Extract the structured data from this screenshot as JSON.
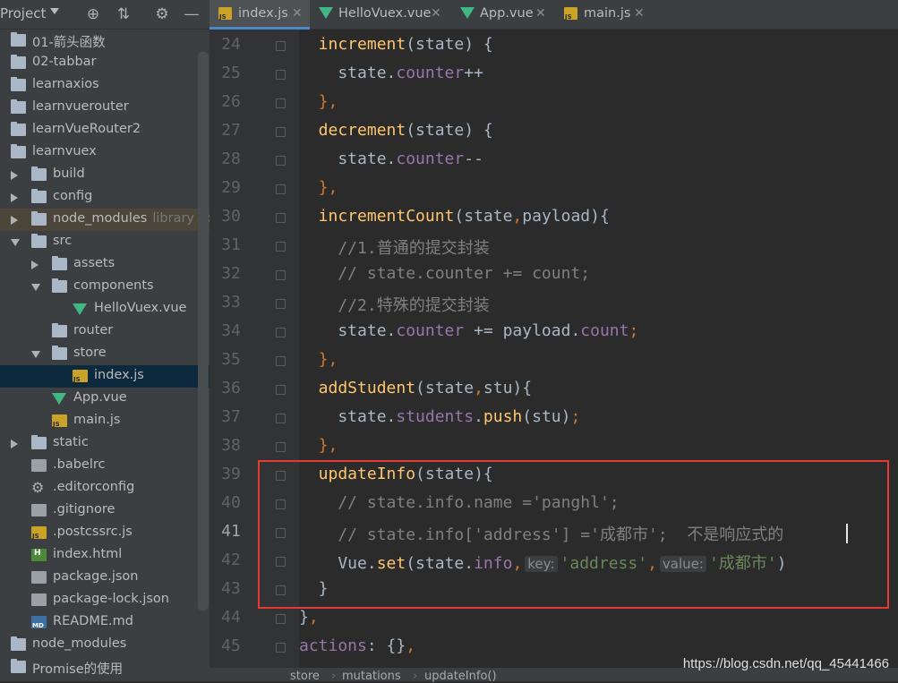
{
  "sidebar": {
    "title": "Project",
    "tools": [
      "target-icon",
      "collapse-icon",
      "gear-icon",
      "minimize-icon"
    ],
    "items": [
      {
        "label": "01-箭头函数",
        "icon": "folder",
        "depth": 0,
        "arrow": "none"
      },
      {
        "label": "02-tabbar",
        "icon": "folder",
        "depth": 0,
        "arrow": "none"
      },
      {
        "label": "learnaxios",
        "icon": "folder",
        "depth": 0,
        "arrow": "none"
      },
      {
        "label": "learnvuerouter",
        "icon": "folder",
        "depth": 0,
        "arrow": "none"
      },
      {
        "label": "learnVueRouter2",
        "icon": "folder",
        "depth": 0,
        "arrow": "none"
      },
      {
        "label": "learnvuex",
        "icon": "folder",
        "depth": 0,
        "arrow": "none"
      },
      {
        "label": "build",
        "icon": "folder",
        "depth": 1,
        "arrow": "right"
      },
      {
        "label": "config",
        "icon": "folder",
        "depth": 1,
        "arrow": "right"
      },
      {
        "label": "node_modules",
        "icon": "folder",
        "depth": 1,
        "arrow": "right",
        "suffix": "library roo",
        "state": "excluded"
      },
      {
        "label": "src",
        "icon": "folder",
        "depth": 1,
        "arrow": "down"
      },
      {
        "label": "assets",
        "icon": "folder",
        "depth": 2,
        "arrow": "right"
      },
      {
        "label": "components",
        "icon": "folder",
        "depth": 2,
        "arrow": "down"
      },
      {
        "label": "HelloVuex.vue",
        "icon": "vue",
        "depth": 3,
        "arrow": "none"
      },
      {
        "label": "router",
        "icon": "folder",
        "depth": 2,
        "arrow": "none"
      },
      {
        "label": "store",
        "icon": "folder",
        "depth": 2,
        "arrow": "down"
      },
      {
        "label": "index.js",
        "icon": "js",
        "depth": 3,
        "arrow": "none",
        "state": "selected"
      },
      {
        "label": "App.vue",
        "icon": "vue",
        "depth": 2,
        "arrow": "none"
      },
      {
        "label": "main.js",
        "icon": "js",
        "depth": 2,
        "arrow": "none"
      },
      {
        "label": "static",
        "icon": "folder",
        "depth": 1,
        "arrow": "right"
      },
      {
        "label": ".babelrc",
        "icon": "file",
        "depth": 1,
        "arrow": "none"
      },
      {
        "label": ".editorconfig",
        "icon": "gear",
        "depth": 1,
        "arrow": "none"
      },
      {
        "label": ".gitignore",
        "icon": "file",
        "depth": 1,
        "arrow": "none"
      },
      {
        "label": ".postcssrc.js",
        "icon": "js",
        "depth": 1,
        "arrow": "none"
      },
      {
        "label": "index.html",
        "icon": "html",
        "depth": 1,
        "arrow": "none"
      },
      {
        "label": "package.json",
        "icon": "file",
        "depth": 1,
        "arrow": "none"
      },
      {
        "label": "package-lock.json",
        "icon": "file",
        "depth": 1,
        "arrow": "none"
      },
      {
        "label": "README.md",
        "icon": "md",
        "depth": 1,
        "arrow": "none"
      },
      {
        "label": "node_modules",
        "icon": "folder",
        "depth": 0,
        "arrow": "none"
      },
      {
        "label": "Promise的使用",
        "icon": "folder",
        "depth": 0,
        "arrow": "none"
      }
    ]
  },
  "tabs": [
    {
      "label": "index.js",
      "icon": "js",
      "active": true
    },
    {
      "label": "HelloVuex.vue",
      "icon": "vue",
      "active": false
    },
    {
      "label": "App.vue",
      "icon": "vue",
      "active": false
    },
    {
      "label": "main.js",
      "icon": "js",
      "active": false
    }
  ],
  "editor": {
    "current_line": 41,
    "lines": [
      {
        "n": 24,
        "tokens": [
          [
            "  increment",
            "kw-fn"
          ],
          [
            "(state) {",
            ""
          ]
        ]
      },
      {
        "n": 25,
        "tokens": [
          [
            "    state.",
            ""
          ],
          [
            "counter",
            "prop"
          ],
          [
            "++",
            ""
          ]
        ]
      },
      {
        "n": 26,
        "tokens": [
          [
            "  },",
            "kw"
          ]
        ]
      },
      {
        "n": 27,
        "tokens": [
          [
            "  decrement",
            "kw-fn"
          ],
          [
            "(state) {",
            ""
          ]
        ]
      },
      {
        "n": 28,
        "tokens": [
          [
            "    state.",
            ""
          ],
          [
            "counter",
            "prop"
          ],
          [
            "--",
            ""
          ]
        ]
      },
      {
        "n": 29,
        "tokens": [
          [
            "  },",
            "kw"
          ]
        ]
      },
      {
        "n": 30,
        "tokens": [
          [
            "  incrementCount",
            "kw-fn"
          ],
          [
            "(state",
            ""
          ],
          [
            ",",
            "kw"
          ],
          [
            "payload){",
            ""
          ]
        ]
      },
      {
        "n": 31,
        "tokens": [
          [
            "    //1.普通的提交封装",
            "cm"
          ]
        ]
      },
      {
        "n": 32,
        "tokens": [
          [
            "    // state.counter += count;",
            "cm"
          ]
        ]
      },
      {
        "n": 33,
        "tokens": [
          [
            "    //2.特殊的提交封装",
            "cm"
          ]
        ]
      },
      {
        "n": 34,
        "tokens": [
          [
            "    state.",
            ""
          ],
          [
            "counter",
            "prop"
          ],
          [
            " += payload.",
            ""
          ],
          [
            "count",
            "prop"
          ],
          [
            ";",
            "kw"
          ]
        ]
      },
      {
        "n": 35,
        "tokens": [
          [
            "  },",
            "kw"
          ]
        ]
      },
      {
        "n": 36,
        "tokens": [
          [
            "  addStudent",
            "kw-fn"
          ],
          [
            "(state",
            ""
          ],
          [
            ",",
            "kw"
          ],
          [
            "stu){",
            ""
          ]
        ]
      },
      {
        "n": 37,
        "tokens": [
          [
            "    state.",
            ""
          ],
          [
            "students",
            "prop"
          ],
          [
            ".",
            ""
          ],
          [
            "push",
            "kw-fn"
          ],
          [
            "(stu)",
            ""
          ],
          [
            ";",
            "kw"
          ]
        ]
      },
      {
        "n": 38,
        "tokens": [
          [
            "  },",
            "kw"
          ]
        ]
      },
      {
        "n": 39,
        "tokens": [
          [
            "  updateInfo",
            "kw-fn"
          ],
          [
            "(state){",
            ""
          ]
        ]
      },
      {
        "n": 40,
        "tokens": [
          [
            "    // state.info.name ='panghl';",
            "cm"
          ]
        ]
      },
      {
        "n": 41,
        "tokens": [
          [
            "    // state.info['address'] ='成都市';  不是响应式的",
            "cm"
          ]
        ]
      },
      {
        "n": 42,
        "tokens": [
          [
            "    Vue.",
            ""
          ],
          [
            "set",
            "kw-fn"
          ],
          [
            "(state.",
            ""
          ],
          [
            "info",
            "prop"
          ],
          [
            ",",
            "kw"
          ],
          [
            "key:",
            "hint"
          ],
          [
            "'address'",
            "str"
          ],
          [
            ",",
            "kw"
          ],
          [
            "value:",
            "hint"
          ],
          [
            "'成都市'",
            "str"
          ],
          [
            ")",
            ""
          ]
        ]
      },
      {
        "n": 43,
        "tokens": [
          [
            "  }",
            ""
          ]
        ]
      },
      {
        "n": 44,
        "tokens": [
          [
            "}",
            ""
          ],
          [
            ",",
            "kw"
          ]
        ]
      },
      {
        "n": 45,
        "tokens": [
          [
            "actions",
            "prop"
          ],
          [
            ": {}",
            ""
          ],
          [
            ",",
            "kw"
          ]
        ]
      }
    ]
  },
  "breadcrumb": [
    "store",
    "mutations",
    "updateInfo()"
  ],
  "watermark": "https://blog.csdn.net/qq_45441466",
  "colors": {
    "accent": "#4a88c7",
    "highlight_box": "#e53935"
  }
}
